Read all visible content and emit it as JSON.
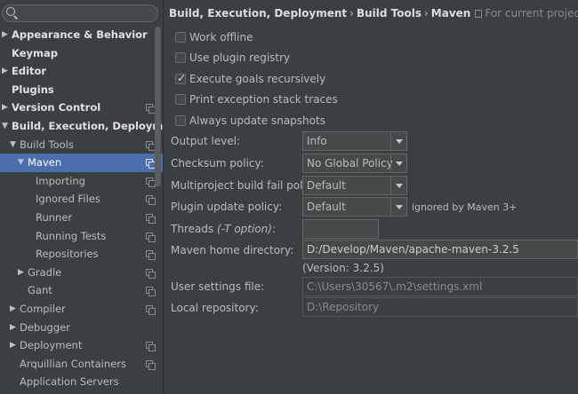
{
  "sidebar": {
    "search": {
      "placeholder": ""
    },
    "items": [
      {
        "label": "Appearance & Behavior",
        "arrow": "▶",
        "bold": true,
        "copy": false
      },
      {
        "label": "Keymap",
        "arrow": "",
        "bold": true,
        "copy": false
      },
      {
        "label": "Editor",
        "arrow": "▶",
        "bold": true,
        "copy": false
      },
      {
        "label": "Plugins",
        "arrow": "",
        "bold": true,
        "copy": false
      },
      {
        "label": "Version Control",
        "arrow": "▶",
        "bold": true,
        "copy": true
      },
      {
        "label": "Build, Execution, Deployment",
        "arrow": "▼",
        "bold": true,
        "copy": false
      },
      {
        "label": "Build Tools",
        "arrow": "▼",
        "bold": false,
        "copy": true
      },
      {
        "label": "Maven",
        "arrow": "▼",
        "bold": false,
        "copy": true,
        "selected": true
      },
      {
        "label": "Importing",
        "arrow": "",
        "bold": false,
        "copy": true
      },
      {
        "label": "Ignored Files",
        "arrow": "",
        "bold": false,
        "copy": true
      },
      {
        "label": "Runner",
        "arrow": "",
        "bold": false,
        "copy": true
      },
      {
        "label": "Running Tests",
        "arrow": "",
        "bold": false,
        "copy": true
      },
      {
        "label": "Repositories",
        "arrow": "",
        "bold": false,
        "copy": true
      },
      {
        "label": "Gradle",
        "arrow": "▶",
        "bold": false,
        "copy": true
      },
      {
        "label": "Gant",
        "arrow": "",
        "bold": false,
        "copy": true
      },
      {
        "label": "Compiler",
        "arrow": "▶",
        "bold": false,
        "copy": true
      },
      {
        "label": "Debugger",
        "arrow": "▶",
        "bold": false,
        "copy": false
      },
      {
        "label": "Deployment",
        "arrow": "▶",
        "bold": false,
        "copy": true
      },
      {
        "label": "Arquillian Containers",
        "arrow": "",
        "bold": false,
        "copy": true
      },
      {
        "label": "Application Servers",
        "arrow": "",
        "bold": false,
        "copy": false
      }
    ]
  },
  "breadcrumb": {
    "parts": [
      "Build, Execution, Deployment",
      "Build Tools",
      "Maven"
    ],
    "separator": "›",
    "hint": "For current project"
  },
  "options": {
    "work_offline": {
      "label": "Work offline",
      "checked": false
    },
    "use_plugin_registry": {
      "label": "Use plugin registry",
      "checked": false
    },
    "execute_goals_recursively": {
      "label": "Execute goals recursively",
      "checked": true
    },
    "print_exception_stack_traces": {
      "label": "Print exception stack traces",
      "checked": false
    },
    "always_update_snapshots": {
      "label": "Always update snapshots",
      "checked": false
    }
  },
  "form": {
    "output_level": {
      "label": "Output level:",
      "value": "Info"
    },
    "checksum_policy": {
      "label": "Checksum policy:",
      "value": "No Global Policy"
    },
    "multiproject_fail_policy": {
      "label": "Multiproject build fail policy:",
      "value": "Default"
    },
    "plugin_update_policy": {
      "label": "Plugin update policy:",
      "value": "Default",
      "note": "ignored by Maven 3+"
    },
    "threads": {
      "label": "Threads ",
      "label_suffix": "(-T option)",
      "label_end": ":",
      "value": ""
    },
    "maven_home": {
      "label": "Maven home directory:",
      "value": "D:/Develop/Maven/apache-maven-3.2.5",
      "version": "(Version: 3.2.5)"
    },
    "user_settings": {
      "label": "User settings file:",
      "value": "C:\\Users\\30567\\.m2\\settings.xml"
    },
    "local_repository": {
      "label": "Local repository:",
      "value": "D:\\Repository"
    }
  },
  "colors": {
    "background": "#3c3f41",
    "selection": "#4b6eaf",
    "text": "#bbbbbb"
  }
}
